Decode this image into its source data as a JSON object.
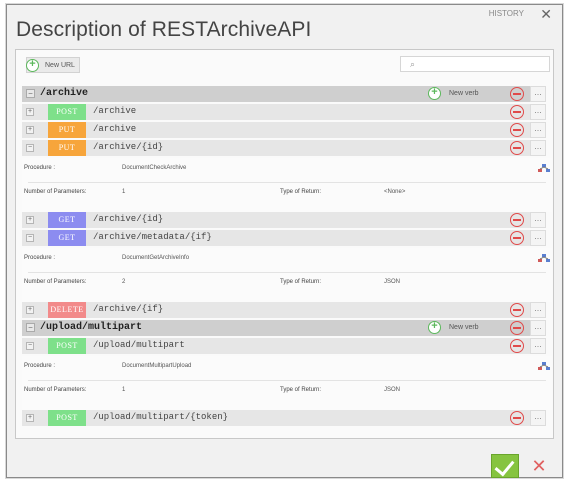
{
  "window": {
    "title": "Description of RESTArchiveAPI",
    "controls_label": "HISTORY",
    "close_glyph": "✕"
  },
  "toolbar": {
    "new_url_label": "New URL",
    "search_value": "",
    "search_icon": "search-icon"
  },
  "groups": [
    {
      "path": "/archive",
      "new_verb_label": "New verb",
      "verbs": [
        {
          "method": "POST",
          "path": "/archive",
          "color": "#7ee08a",
          "expanded": false
        },
        {
          "method": "PUT",
          "path": "/archive",
          "color": "#f7a53b",
          "expanded": false
        },
        {
          "method": "PUT",
          "path": "/archive/{id}",
          "color": "#f7a53b",
          "expanded": true,
          "detail": {
            "procedure_label": "Procedure :",
            "procedure": "DocumentCheckArchive",
            "params_label": "Number of Parameters:",
            "params": "1",
            "return_label": "Type of Return:",
            "return": "<None>"
          }
        },
        {
          "method": "GET",
          "path": "/archive/{id}",
          "color": "#8c8cf0",
          "expanded": false
        },
        {
          "method": "GET",
          "path": "/archive/metadata/{if}",
          "color": "#8c8cf0",
          "expanded": true,
          "detail": {
            "procedure_label": "Procedure :",
            "procedure": "DocumentGetArchiveInfo",
            "params_label": "Number of Parameters:",
            "params": "2",
            "return_label": "Type of Return:",
            "return": "JSON"
          }
        },
        {
          "method": "DELETE",
          "path": "/archive/{if}",
          "color": "#f28a8a",
          "expanded": false
        }
      ]
    },
    {
      "path": "/upload/multipart",
      "new_verb_label": "New verb",
      "verbs": [
        {
          "method": "POST",
          "path": "/upload/multipart",
          "color": "#7ee08a",
          "expanded": true,
          "detail": {
            "procedure_label": "Procedure :",
            "procedure": "DocumentMultipartUpload",
            "params_label": "Number of Parameters:",
            "params": "1",
            "return_label": "Type of Return:",
            "return": "JSON"
          }
        },
        {
          "method": "POST",
          "path": "/upload/multipart/{token}",
          "color": "#7ee08a",
          "expanded": false
        }
      ]
    }
  ],
  "more_glyph": "...",
  "footer": {
    "ok_icon": "check-icon",
    "cancel_glyph": "✕",
    "cancel_icon": "close-icon"
  }
}
